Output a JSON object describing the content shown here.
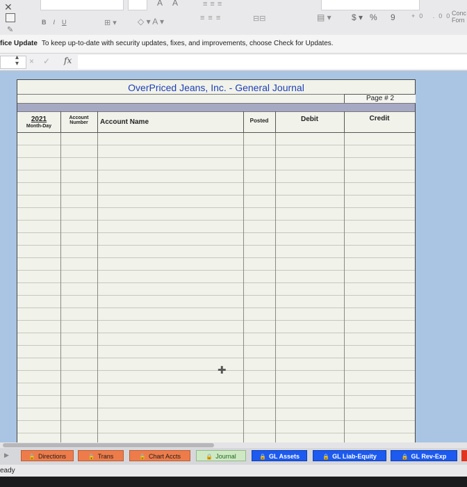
{
  "ribbon": {
    "icons": [
      "cut-icon",
      "copy-icon",
      "format-painter-icon",
      "bold-icon",
      "italic-icon",
      "underline-icon",
      "borders-icon",
      "fill-color-icon",
      "font-color-icon",
      "align-icon",
      "merge-icon",
      "number-format-icon"
    ],
    "bold": "B",
    "italic": "I",
    "underline": "U",
    "font_color": "A",
    "grow_font": "A A",
    "currency": "$",
    "percent": "%",
    "comma": "9",
    "decimals": "+0 .00",
    "conditional_label_1": "Conc",
    "conditional_label_2": "Forn"
  },
  "update_bar": {
    "title": "fice Update",
    "message": "To keep up-to-date with security updates, fixes, and improvements, choose Check for Updates."
  },
  "formula_bar": {
    "cancel": "×",
    "confirm": "✓",
    "fx": "fx",
    "value": ""
  },
  "journal": {
    "title": "OverPriced Jeans, Inc.  -  General Journal",
    "page_label": "Page # 2",
    "columns": {
      "date_year": "2021",
      "date_sub": "Month-Day",
      "account_1": "Account",
      "account_2": "Number",
      "account_name": "Account Name",
      "posted": "Posted",
      "debit": "Debit",
      "credit": "Credit"
    },
    "row_count": 25
  },
  "tabs": [
    {
      "label": "Directions",
      "style": "orange"
    },
    {
      "label": "Trans",
      "style": "orange"
    },
    {
      "label": "Chart Accts",
      "style": "orange"
    },
    {
      "label": "Journal",
      "style": "green",
      "active": true
    },
    {
      "label": "GL Assets",
      "style": "blue"
    },
    {
      "label": "GL Liab-Equity",
      "style": "blue"
    },
    {
      "label": "GL Rev-Exp",
      "style": "blue"
    }
  ],
  "status": {
    "text": "Ready",
    "visible_text": "eady"
  },
  "colors": {
    "sheet_background": "#a9c5e3",
    "title_blue": "#1d3fb5",
    "band": "#a6a9c4",
    "tab_orange": "#ee7c4a",
    "tab_green": "#cfe8c4",
    "tab_blue": "#1c5af0"
  }
}
